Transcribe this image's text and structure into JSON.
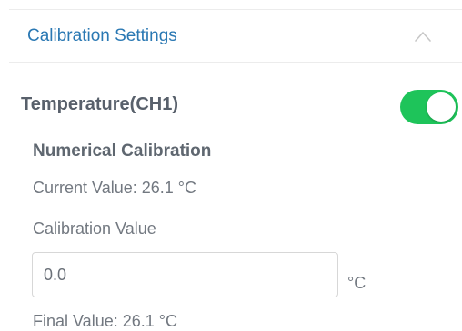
{
  "section": {
    "title": "Calibration Settings",
    "collapse_icon": "chevron-up-icon"
  },
  "channel": {
    "title": "Temperature(CH1)",
    "enabled": true,
    "toggle_color": "#1ec45a"
  },
  "calibration": {
    "subtitle": "Numerical Calibration",
    "current_value": "Current Value: 26.1 °C",
    "value_label": "Calibration Value",
    "input_value": "0.0",
    "unit": "°C",
    "final_value": "Final Value: 26.1 °C"
  },
  "colors": {
    "accent_blue": "#2a78b3",
    "toggle_on": "#1ec45a",
    "text_gray": "#727880"
  }
}
